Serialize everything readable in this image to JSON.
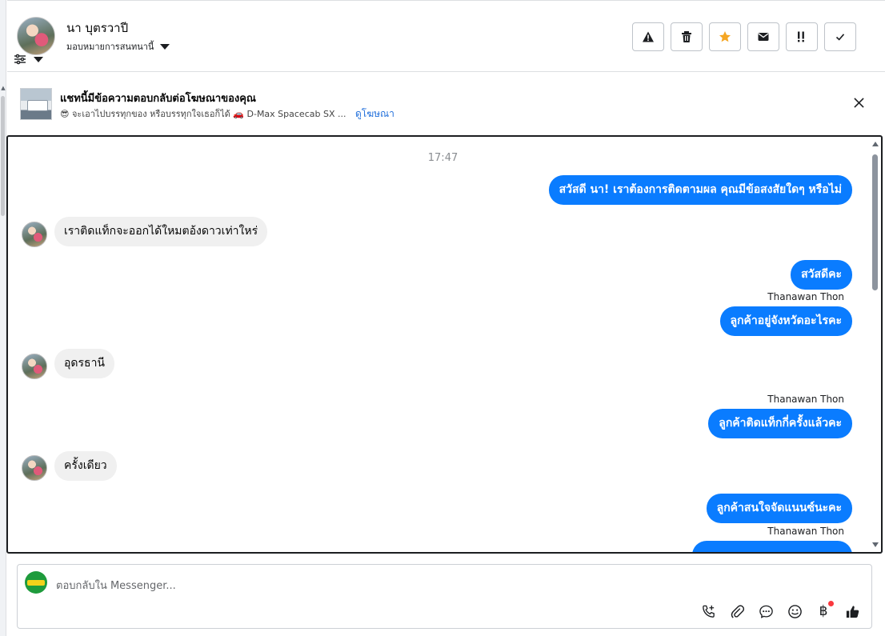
{
  "header": {
    "contact_name": "นา บุตรวาปี",
    "assign_label": "มอบหมายการสนทนานี้",
    "actions": [
      {
        "name": "report-spam-button",
        "icon": "warning-triangle-icon"
      },
      {
        "name": "delete-button",
        "icon": "trash-icon"
      },
      {
        "name": "star-button",
        "icon": "star-icon"
      },
      {
        "name": "mark-unread-button",
        "icon": "envelope-icon"
      },
      {
        "name": "follow-up-button",
        "icon": "important-icon"
      },
      {
        "name": "mark-done-button",
        "icon": "check-icon"
      }
    ]
  },
  "ad": {
    "title": "แชทนี้มีข้อความตอบกลับต่อโฆษณาของคุณ",
    "emoji": "😎",
    "subtitle": "จะเอาไปบรรทุกของ หรือบรรทุกใจเธอก็ได้",
    "car_emoji": "🚗",
    "car_text": "D-Max Spacecab SX ...",
    "link_label": "ดูโฆษณา"
  },
  "chat": {
    "timestamp": "17:47",
    "messages": [
      {
        "dir": "out",
        "text": "สวัสดี นา! เราต้องการติดตามผล คุณมีข้อสงสัยใดๆ หรือไม่"
      },
      {
        "dir": "in",
        "text": "เราติดแท็กจะออกได้ใหมตอ้งดาวเท่าใหร่"
      },
      {
        "dir": "out",
        "text": "สวัสดีคะ"
      },
      {
        "sender": "Thanawan Thon"
      },
      {
        "dir": "out",
        "text": "ลูกค้าอยู่จังหวัดอะไรคะ"
      },
      {
        "dir": "in",
        "text": "อุดรธานี"
      },
      {
        "sender": "Thanawan Thon"
      },
      {
        "dir": "out",
        "text": "ลูกค้าติดแท็กกี่ครั้งแล้วคะ"
      },
      {
        "dir": "in",
        "text": "ครั้งเดียว"
      },
      {
        "dir": "out",
        "text": "ลูกค้าสนใจจัดแนนซ์นะคะ"
      },
      {
        "sender": "Thanawan Thon"
      }
    ]
  },
  "composer": {
    "placeholder": "ตอบกลับใน Messenger..."
  },
  "colors": {
    "outgoing_bubble": "#0a7cff",
    "incoming_bubble": "#f0f0f0",
    "link": "#216fdb",
    "star": "#f5a623"
  }
}
